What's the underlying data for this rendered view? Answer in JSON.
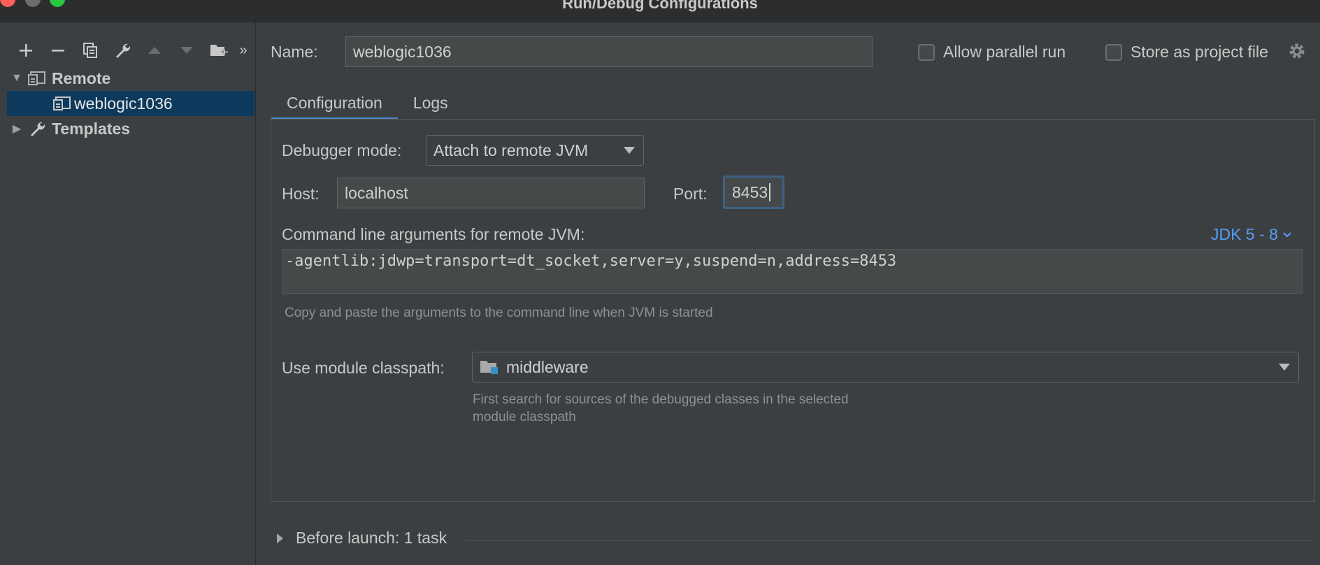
{
  "window": {
    "title": "Run/Debug Configurations"
  },
  "toolbar": {
    "icons": [
      "plus-icon",
      "minus-icon",
      "copy-icon",
      "wrench-icon",
      "arrow-up-icon",
      "arrow-down-icon",
      "folder-add-icon",
      "more-icon"
    ],
    "more_label": "»"
  },
  "tree": {
    "remote": {
      "label": "Remote",
      "expanded": true
    },
    "child": {
      "label": "weblogic1036",
      "selected": true
    },
    "templates": {
      "label": "Templates",
      "expanded": false
    }
  },
  "form": {
    "name_label": "Name:",
    "name_value": "weblogic1036",
    "allow_parallel": {
      "label": "Allow parallel run",
      "checked": false
    },
    "store_project": {
      "label": "Store as project file",
      "checked": false
    }
  },
  "tabs": [
    {
      "label": "Configuration",
      "active": true
    },
    {
      "label": "Logs",
      "active": false
    }
  ],
  "config": {
    "debugger_mode_label": "Debugger mode:",
    "debugger_mode_value": "Attach to remote JVM",
    "host_label": "Host:",
    "host_value": "localhost",
    "port_label": "Port:",
    "port_value": "8453",
    "cmd_label": "Command line arguments for remote JVM:",
    "jdk_link": "JDK 5 - 8",
    "cmd_value": "-agentlib:jdwp=transport=dt_socket,server=y,suspend=n,address=8453",
    "cmd_hint": "Copy and paste the arguments to the command line when JVM is started",
    "module_label": "Use module classpath:",
    "module_value": "middleware",
    "module_hint_line1": "First search for sources of the debugged classes in the selected",
    "module_hint_line2": "module classpath"
  },
  "before_launch": {
    "label": "Before launch: 1 task"
  },
  "colors": {
    "background": "#3c3f41",
    "selection": "#0d3a5c",
    "accent": "#4a88c7",
    "link": "#589df6"
  }
}
